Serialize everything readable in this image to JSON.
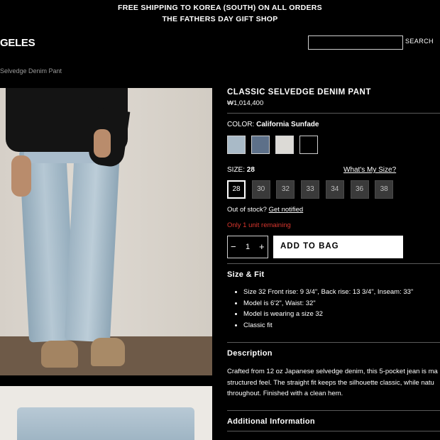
{
  "banner": {
    "line1": "FREE SHIPPING TO KOREA (SOUTH) ON ALL ORDERS",
    "line2": "THE FATHERS DAY GIFT SHOP"
  },
  "header": {
    "logo": "GELES",
    "search_placeholder": "",
    "search_button": "SEARCH"
  },
  "breadcrumb": "Selvedge Denim Pant",
  "product": {
    "name": "CLASSIC SELVEDGE DENIM PANT",
    "price": "₩1,014,400",
    "color_label": "COLOR:",
    "color_value": "California Sunfade",
    "swatches": [
      {
        "name": "California Sunfade",
        "hex": "#a9bac7"
      },
      {
        "name": "Dark Blue",
        "hex": "#5d7089"
      },
      {
        "name": "Natural",
        "hex": "#dcdad6"
      },
      {
        "name": "Black",
        "hex": "#000000"
      }
    ],
    "size_label": "SIZE:",
    "size_value": "28",
    "size_guide": "What's My Size?",
    "sizes": [
      "28",
      "30",
      "32",
      "33",
      "34",
      "36",
      "38"
    ],
    "out_of_stock": "Out of stock?",
    "get_notified": "Get notified",
    "remaining": "Only 1 unit remaining",
    "quantity": "1",
    "qty_minus": "−",
    "qty_plus": "+",
    "add_to_bag": "ADD TO BAG"
  },
  "size_fit": {
    "title": "Size & Fit",
    "items": [
      "Size 32 Front rise: 9 3/4\", Back rise: 13 3/4\", Inseam: 33\"",
      "Model is 6'2\", Waist: 32\"",
      "Model is wearing a size 32",
      "Classic fit"
    ]
  },
  "description": {
    "title": "Description",
    "lines": [
      "Crafted from 12 oz Japanese selvedge denim, this 5-pocket jean is ma",
      "structured feel. The straight fit keeps the silhouette classic, while natu",
      "throughout. Finished with a clean hem."
    ]
  },
  "additional": {
    "title": "Additional Information"
  },
  "colors": {
    "accent_red": "#d9362e"
  }
}
